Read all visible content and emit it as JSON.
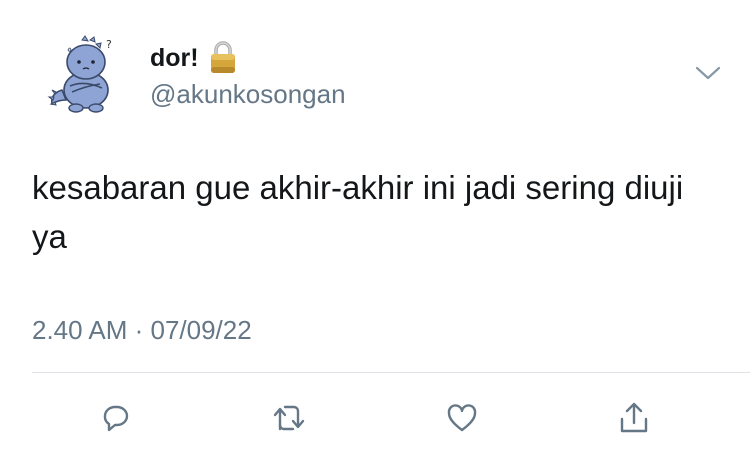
{
  "user": {
    "display_name": "dor!",
    "handle": "@akunkosongan",
    "avatar": "blue-dinosaur-avatar",
    "protected_icon": "lock-icon"
  },
  "tweet": {
    "text": "kesabaran gue akhir-akhir ini jadi sering diuji ya",
    "timestamp": "2.40 AM · 07/09/22"
  },
  "icons": {
    "menu": "chevron-down-icon",
    "reply": "reply-icon",
    "retweet": "retweet-icon",
    "like": "like-icon",
    "share": "share-icon"
  },
  "colors": {
    "text": "#14171a",
    "secondary": "#657786",
    "divider": "#dfe3e7",
    "avatar_blue": "#8ea4d4"
  }
}
